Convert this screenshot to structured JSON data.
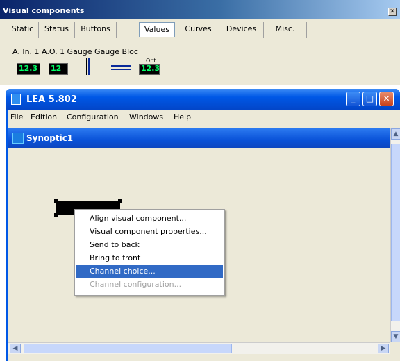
{
  "palette": {
    "title": "Visual components",
    "close_glyph": "✕",
    "tabs": [
      "Static",
      "Status",
      "Buttons",
      "Values",
      "Curves",
      "Devices",
      "Misc."
    ],
    "active_tab": "Values",
    "component_labels": "A. In. 1  A.O. 1  Gauge  Gauge    Bloc",
    "components": [
      {
        "name": "analog-input-icon",
        "text": "12.3"
      },
      {
        "name": "analog-output-icon",
        "text": "12"
      },
      {
        "name": "vertical-gauge-icon",
        "text": ""
      },
      {
        "name": "horizontal-gauge-icon",
        "text": ""
      },
      {
        "name": "bloc-icon",
        "text": "12.3",
        "badge": "Opt"
      }
    ]
  },
  "lea_window": {
    "title": "LEA 5.802",
    "menu": [
      "File",
      "Edition",
      "Configuration",
      "Windows",
      "Help"
    ],
    "buttons": {
      "minimize": "_",
      "maximize": "□",
      "close": "✕"
    }
  },
  "synoptic": {
    "title": "Synoptic1",
    "scroll_glyphs": {
      "up": "▲",
      "down": "▼",
      "left": "◀",
      "right": "▶"
    }
  },
  "context_menu": [
    {
      "label": "Align visual component...",
      "state": "normal"
    },
    {
      "label": "Visual component properties...",
      "state": "normal"
    },
    {
      "label": "Send to back",
      "state": "normal"
    },
    {
      "label": "Bring to front",
      "state": "normal"
    },
    {
      "label": "Channel choice...",
      "state": "highlighted"
    },
    {
      "label": "Channel configuration...",
      "state": "disabled"
    }
  ],
  "colors": {
    "highlight": "#316ac5",
    "xp_blue": "#0058e6",
    "panel": "#ece9d8",
    "display_green": "#00ff66"
  }
}
